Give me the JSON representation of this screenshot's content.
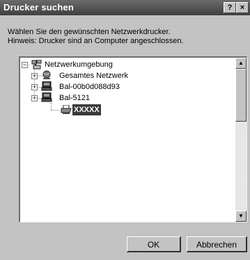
{
  "window": {
    "title": "Drucker suchen",
    "help_label": "?",
    "close_label": "×"
  },
  "instructions": {
    "line1": "Wählen Sie den gewünschten Netzwerkdrucker.",
    "line2": "Hinweis: Drucker sind an Computer angeschlossen."
  },
  "tree": {
    "root": {
      "label": "Netzwerkumgebung",
      "expander": "−",
      "icon": "network-neighborhood-icon"
    },
    "children": [
      {
        "label": "Gesamtes Netzwerk",
        "expander": "+",
        "icon": "globe-icon"
      },
      {
        "label": "Bal-00b0d088d93",
        "expander": "+",
        "icon": "computer-icon"
      },
      {
        "label": "Bal-5121",
        "expander": "+",
        "icon": "computer-icon"
      }
    ],
    "selected_printer": {
      "label": "XXXXX",
      "icon": "printer-icon"
    }
  },
  "scrollbar": {
    "up_arrow": "▲",
    "down_arrow": "▼"
  },
  "buttons": {
    "ok_label": "OK",
    "cancel_label": "Abbrechen"
  }
}
